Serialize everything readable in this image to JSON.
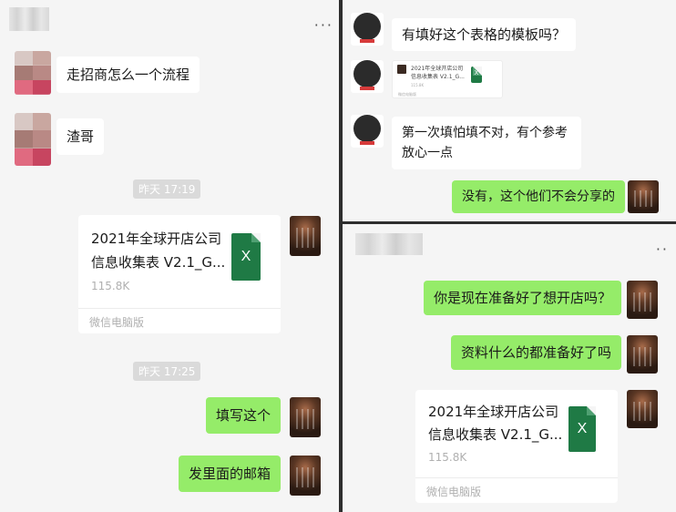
{
  "left_panel": {
    "more_label": "···",
    "messages": [
      {
        "text": "走招商怎么一个流程"
      },
      {
        "text": "渣哥"
      }
    ],
    "timestamp_1": "昨天 17:19",
    "file_card": {
      "title_line1": "2021年全球开店公司",
      "title_line2": "信息收集表 V2.1_G...",
      "size": "115.8K",
      "source": "微信电脑版",
      "file_icon_letter": "X"
    },
    "timestamp_2": "昨天 17:25",
    "my_messages": [
      {
        "text": "填写这个"
      },
      {
        "text": "发里面的邮箱"
      }
    ]
  },
  "top_right_panel": {
    "messages": [
      {
        "text": "有填好这个表格的模板吗？"
      },
      {
        "text_line1": "第一次填怕填不对，有个参考",
        "text_line2": "放心一点"
      }
    ],
    "mini_card": {
      "title_line1": "2021年全球开店公司",
      "title_line2": "信息收集表 V2.1_G...",
      "size": "115.8K",
      "source": "微信电脑版",
      "file_icon_letter": "X"
    },
    "my_reply": "没有，这个他们不会分享的"
  },
  "bottom_right_panel": {
    "more_label": "··",
    "my_messages": [
      {
        "text": "你是现在准备好了想开店吗？"
      },
      {
        "text": "资料什么的都准备好了吗"
      }
    ],
    "file_card": {
      "title_line1": "2021年全球开店公司",
      "title_line2": "信息收集表 V2.1_G...",
      "size": "115.8K",
      "source": "微信电脑版",
      "file_icon_letter": "X"
    }
  },
  "colors": {
    "chat_background": "#f5f5f5",
    "my_bubble": "#95ec69",
    "their_bubble": "#ffffff",
    "excel_green": "#1f7a45"
  }
}
